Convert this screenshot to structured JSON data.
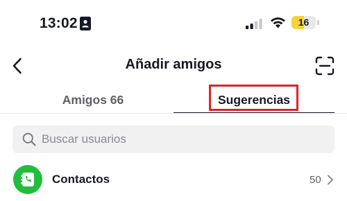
{
  "status_bar": {
    "time": "13:02",
    "battery_level": "16",
    "battery_fraction": 0.16,
    "icons": [
      "id-card-icon",
      "signal-icon",
      "wifi-icon",
      "battery-icon"
    ]
  },
  "header": {
    "title": "Añadir amigos",
    "back_icon": "chevron-left-icon",
    "scan_icon": "scan-icon"
  },
  "tabs": [
    {
      "label": "Amigos 66",
      "selected": false
    },
    {
      "label": "Sugerencias",
      "selected": true
    }
  ],
  "search": {
    "placeholder": "Buscar usuarios",
    "value": ""
  },
  "contacts": {
    "label": "Contactos",
    "count": "50",
    "icon": "phone-book-icon"
  },
  "colors": {
    "highlight_box": "#e02323",
    "contacts_green": "#1fbf3b",
    "battery_yellow": "#f5d43a",
    "text_primary": "#161823",
    "text_secondary": "#5f6066"
  }
}
